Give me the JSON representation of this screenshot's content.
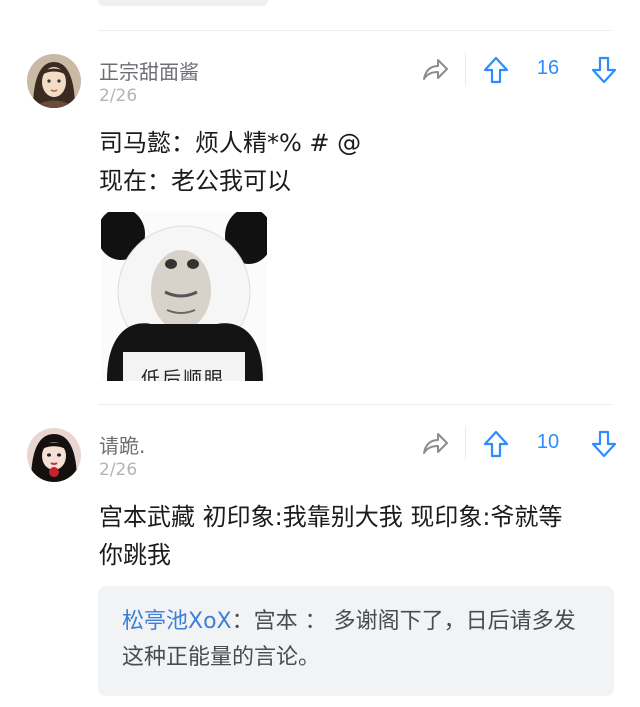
{
  "comments": [
    {
      "username": "正宗甜面酱",
      "date": "2/26",
      "likes": "16",
      "lines": [
        "司马懿：烦人精*% # @",
        "现在：老公我可以"
      ],
      "image": {
        "caption": "低后顺眼",
        "icon": "panda-meme-image"
      }
    },
    {
      "username": "请跪.",
      "date": "2/26",
      "likes": "10",
      "lines": [
        "宫本武藏 初印象:我靠别大我 现印象:爷就等",
        "你跳我"
      ],
      "reply": {
        "user": "松亭池XoX",
        "separator": "：",
        "text": "宫本 ： 多谢阁下了，日后请多发这种正能量的言论。"
      }
    }
  ],
  "icons": {
    "share": "share-icon",
    "upvote": "upvote-arrow-icon",
    "downvote": "downvote-arrow-icon"
  },
  "colors": {
    "accent": "#2d8cff",
    "reply_user": "#3d7fd9",
    "muted": "#b2b4b8"
  }
}
